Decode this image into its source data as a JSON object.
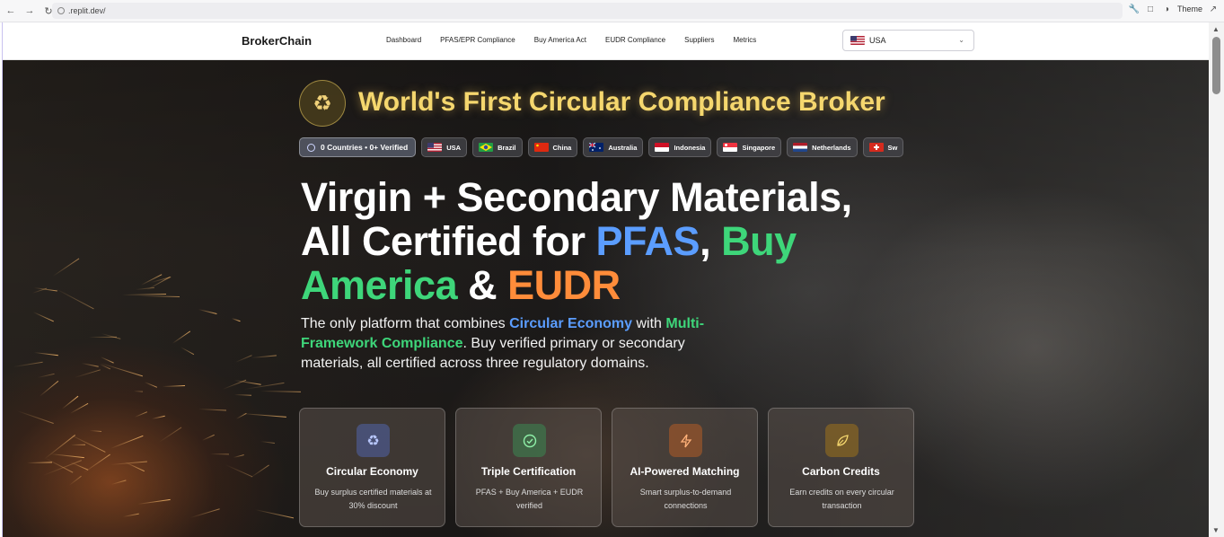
{
  "browser": {
    "url": ".replit.dev/",
    "theme_label": "Theme"
  },
  "nav": {
    "brand": "BrokerChain",
    "links": [
      "Dashboard",
      "PFAS/EPR Compliance",
      "Buy America Act",
      "EUDR Compliance",
      "Suppliers",
      "Metrics"
    ],
    "country_selected": "USA"
  },
  "hero": {
    "gold_headline": "World's First Circular Compliance Broker",
    "stats_pill": "0 Countries • 0+ Verified",
    "countries": [
      "USA",
      "Brazil",
      "China",
      "Australia",
      "Indonesia",
      "Singapore",
      "Netherlands",
      "Sw"
    ],
    "title": {
      "part1": "Virgin + Secondary Materials,",
      "part2": "All Certified for ",
      "pfas": "PFAS",
      "comma": ", ",
      "buy_america": "Buy America",
      "amp": " & ",
      "eudr": "EUDR"
    },
    "subtitle": {
      "s1": "The only platform that combines ",
      "circular": "Circular Economy",
      "s2": " with ",
      "multi": "Multi-Framework Compliance",
      "s3": ". Buy verified primary or secondary materials, all certified across three regulatory domains."
    },
    "cards": [
      {
        "title": "Circular Economy",
        "desc": "Buy surplus certified materials at 30% discount",
        "icon": "recycle-icon"
      },
      {
        "title": "Triple Certification",
        "desc": "PFAS + Buy America + EUDR verified",
        "icon": "check-circle-icon"
      },
      {
        "title": "AI-Powered Matching",
        "desc": "Smart surplus-to-demand connections",
        "icon": "lightning-icon"
      },
      {
        "title": "Carbon Credits",
        "desc": "Earn credits on every circular transaction",
        "icon": "leaf-icon"
      }
    ]
  },
  "colors": {
    "gold": "#f5d76e",
    "blue": "#5b9dff",
    "green": "#3ed67a",
    "orange": "#ff8c3a"
  }
}
